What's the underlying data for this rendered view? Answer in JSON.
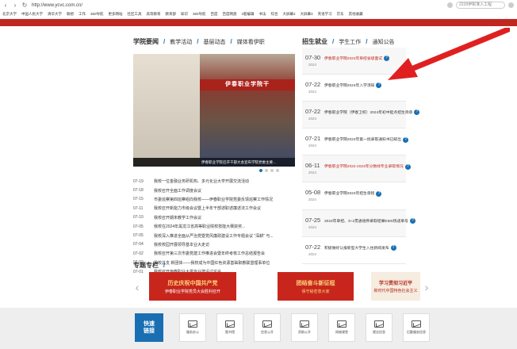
{
  "browser": {
    "url": "http://www.ycvc.com.cn/",
    "search_placeholder": "2228伊犁准入工程",
    "bookmarks": [
      "北京大学",
      "中国人民大学",
      "清华大学",
      "联想",
      "工作",
      "360导航",
      "更多网站",
      "社区工具",
      "高等教育",
      "教育部",
      "知识",
      "360导航",
      "百度",
      "百度网盘",
      "3套编辑",
      "书法",
      "综合",
      "大屏幕2",
      "大屏幕3",
      "英语学习",
      "京东",
      "其他收藏"
    ]
  },
  "news_section": {
    "primary_tab": "学院要闻",
    "tabs": [
      "教学活动",
      "基层动态",
      "媒体看伊职"
    ],
    "photo_sign": "伊春职业学院干",
    "photo_caption": "伊春职业学院召开干部大会宣布学院党委主要...",
    "photo_left_caption": "",
    "items": [
      {
        "date": "07-19",
        "title": "我校一位金融业务研机构、多元化业大学开展交流活动"
      },
      {
        "date": "07-18",
        "title": "我校召开全面工作调度会议"
      },
      {
        "date": "07-15",
        "title": "市委巡察第四巡察组向我校——伊春职业学院党委反馈巡察工作情况"
      },
      {
        "date": "07-11",
        "title": "我校召开新能力市级会议暨上半年干部述职述廉述法工作会议"
      },
      {
        "date": "07-10",
        "title": "我校召开期末教学工作会议"
      },
      {
        "date": "07-05",
        "title": "我校在2024年黑龙江省高等职业院校技能大赛获奖..."
      },
      {
        "date": "07-05",
        "title": "我校深入推进全面从严治党暨党风廉政建设工作专题会议 \"深耕\" 与..."
      },
      {
        "date": "07-04",
        "title": "我校校园开展领导基本业大走访"
      },
      {
        "date": "07-02",
        "title": "我校召开第三次市委党建工作推进会暨年终考核工作总结报告会"
      },
      {
        "date": "07-02",
        "title": "我校总支 新团体——我校成为中国红色资源基础职教联盟理事单位"
      },
      {
        "date": "07-01",
        "title": "我校召开伊春职业大学专业建设讨论会"
      }
    ]
  },
  "enroll_section": {
    "primary_tab": "招生就业",
    "tabs": [
      "学生工作",
      "通知公告"
    ],
    "items": [
      {
        "md": "07-30",
        "year": "2024",
        "title": "伊春职业学院2024年单招省级面试",
        "highlight": true
      },
      {
        "md": "07-22",
        "year": "2024",
        "title": "伊春职业学院2024年入学须知",
        "highlight": false
      },
      {
        "md": "07-22",
        "year": "2024",
        "title": "伊春职业学院（伊春卫校）2024年初中起点招生简章",
        "highlight": false
      },
      {
        "md": "07-21",
        "year": "2024",
        "title": "伊春职业学院2024年第一批录取通知书已邮出",
        "highlight": false
      },
      {
        "md": "06-11",
        "year": "2024",
        "title": "伊春职业学院2022-2023年分数线专业录取情况",
        "highlight": true
      },
      {
        "md": "05-08",
        "year": "2024",
        "title": "伊春职业学院2024年招生章程",
        "highlight": false
      },
      {
        "md": "07-25",
        "year": "2024",
        "title": "2024年单招、3+2贯通培养录取结果EMS快递单号",
        "highlight": false
      },
      {
        "md": "07-22",
        "year": "2024",
        "title": "积极做好认报新型大学生入住新闻发布",
        "highlight": false
      }
    ]
  },
  "special_section": {
    "primary_tab": "专题专栏",
    "banners": [
      {
        "line1": "历史庆祝中国共产党",
        "line2": "伊春职业学院党员大会胜利召开"
      },
      {
        "line1": "团结奋斗新征程",
        "line2": "保守秘密意大家"
      },
      {
        "line1": "学习贯彻习近平",
        "line2": "新时代中国特色社会主义"
      }
    ]
  },
  "footer": {
    "quick_line1": "快速",
    "quick_line2": "链接",
    "links": [
      "服务办公",
      "图书馆",
      "信息公开",
      "资助公开",
      "网络课堂",
      "就业信息",
      "后勤服务信息"
    ]
  },
  "colors": {
    "brand_red": "#c0281f",
    "accent_blue": "#1a6fb3",
    "annotation_arrow": "#e02020"
  }
}
